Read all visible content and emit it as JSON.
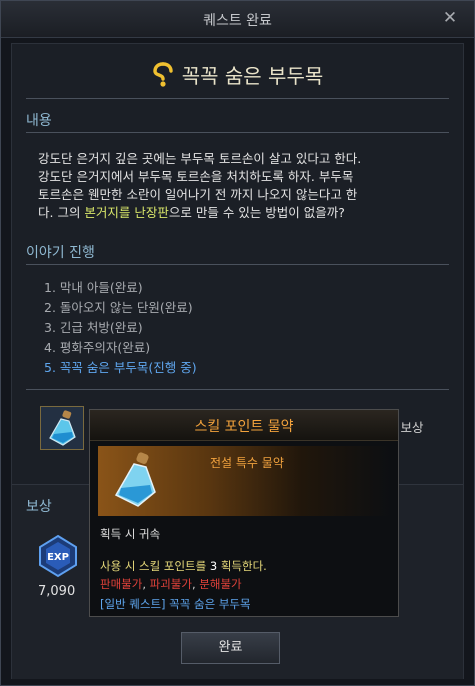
{
  "window": {
    "title": "퀘스트 완료",
    "close_label": "✕"
  },
  "quest": {
    "title": "꼭꼭 숨은 부두목"
  },
  "content": {
    "header": "내용",
    "line1": "강도단 은거지 깊은 곳에는 부두목 토르손이 살고 있다고 한다.",
    "line2": "강도단 은거지에서 부두목 토르손을 처치하도록 하자. 부두목",
    "line3": "토르손은 웬만한 소란이 일어나기 전 까지 나오지 않는다고 한",
    "line4_pre": "다. 그의 ",
    "line4_hl": "본거지를 난장판",
    "line4_post": "으로 만들 수 있는 방법이 없을까?"
  },
  "story": {
    "header": "이야기 진행",
    "steps": [
      "1. 막내 아들(완료)",
      "2. 돌아오지 않는 단원(완료)",
      "3. 긴급 처방(완료)",
      "4. 평화주의자(완료)"
    ],
    "current": "5. 꼭꼭 숨은 부두목(진행 중)"
  },
  "final_reward_label": "종 보상",
  "reward": {
    "header": "보상",
    "exp_label": "EXP",
    "exp_value": "7,090"
  },
  "complete_button": "완료",
  "tooltip": {
    "name": "스킬 포인트 물약",
    "grade": "전설 특수 물약",
    "bind": "획득 시 귀속",
    "usage_pre": "사용 시 스킬 포인트를 ",
    "usage_num": "3",
    "usage_post": " 획득한다.",
    "restrictions": [
      "판매불가",
      "파괴불가",
      "분해불가"
    ],
    "restriction_sep": ", ",
    "source": "[일반 퀘스트] 꼭꼭 숨은 부두목"
  },
  "colors": {
    "accent_blue": "#5fa6ee",
    "legendary_orange": "#f1a23e",
    "highlight": "#d8e66a",
    "restriction_red": "#e0423a",
    "usage_yellow": "#e6d97a"
  }
}
